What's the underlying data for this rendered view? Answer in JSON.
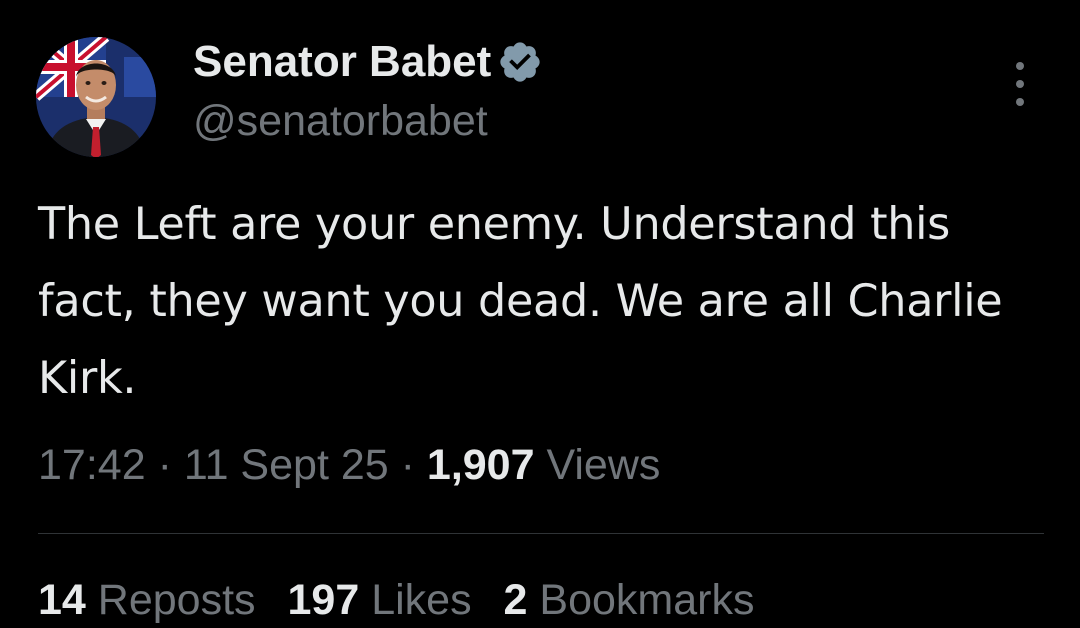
{
  "author": {
    "display_name": "Senator Babet",
    "handle": "@senatorbabet",
    "verified": true,
    "verified_color": "#829aab"
  },
  "tweet": {
    "text": "The Left are your enemy. Understand this fact, they want you dead. We are all Charlie Kirk.",
    "time": "17:42",
    "separator": "·",
    "date": "11 Sept 25",
    "views_count": "1,907",
    "views_label": "Views"
  },
  "stats": {
    "reposts_count": "14",
    "reposts_label": "Reposts",
    "likes_count": "197",
    "likes_label": "Likes",
    "bookmarks_count": "2",
    "bookmarks_label": "Bookmarks"
  },
  "icons": {
    "more": "more-vertical-icon",
    "verified": "verified-badge-icon"
  },
  "colors": {
    "background": "#000000",
    "primary_text": "#e7e9ea",
    "secondary_text": "#71767b",
    "divider": "#2f3336"
  }
}
